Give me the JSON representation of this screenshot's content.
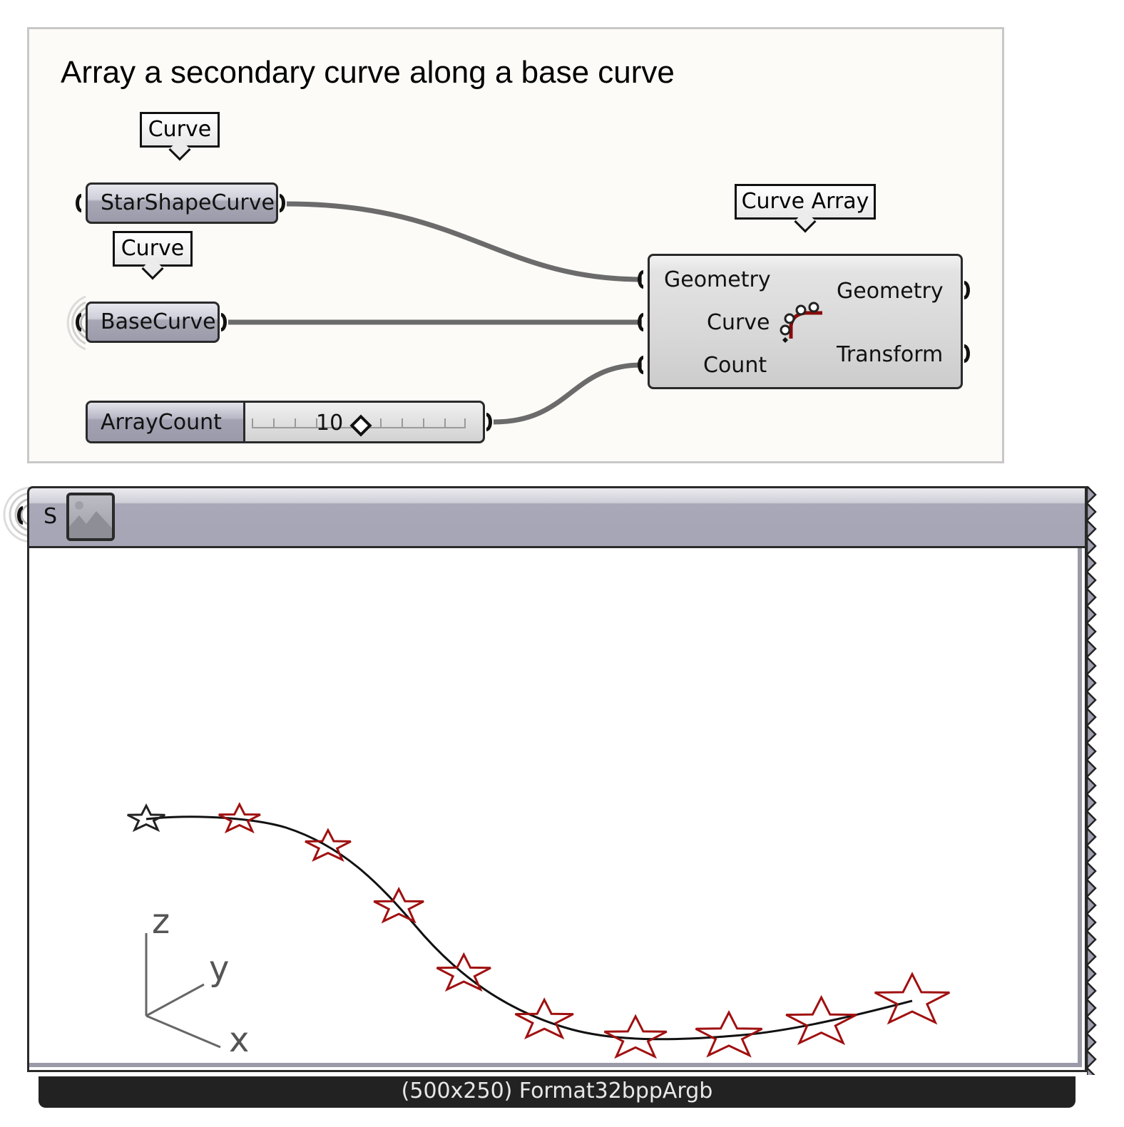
{
  "group": {
    "title": "Array a secondary curve along a base curve",
    "background": "#fcfbf7"
  },
  "balloons": {
    "star_curve_type": "Curve",
    "base_curve_type": "Curve",
    "component_name": "Curve Array"
  },
  "params": {
    "star_shape_curve": "StarShapeCurve",
    "base_curve": "BaseCurve"
  },
  "slider": {
    "name": "ArrayCount",
    "value": "10"
  },
  "component": {
    "name": "Curve Array",
    "icon": "curve-array-icon",
    "inputs": [
      "Geometry",
      "Curve",
      "Count"
    ],
    "outputs": [
      "Geometry",
      "Transform"
    ]
  },
  "panel": {
    "input_label": "S",
    "icon": "image-icon",
    "status": "(500x250) Format32bppArgb",
    "axes": {
      "z": "z",
      "y": "y",
      "x": "x"
    },
    "star_color": "#a01010",
    "curve_color": "#111111",
    "star_count": 10
  }
}
